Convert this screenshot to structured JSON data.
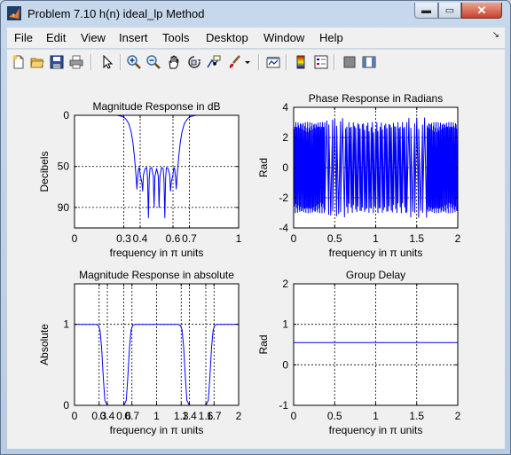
{
  "window": {
    "title": "Problem 7.10 h(n) ideal_lp Method",
    "min_glyph": "▬",
    "max_glyph": "▭",
    "close_glyph": "✕"
  },
  "menu": {
    "items": [
      "File",
      "Edit",
      "View",
      "Insert",
      "Tools",
      "Desktop",
      "Window",
      "Help"
    ],
    "corner_glyph": "↘"
  },
  "toolbar": {
    "icons": [
      "new-figure-icon",
      "open-file-icon",
      "save-icon",
      "print-icon",
      "pointer-icon",
      "zoom-in-icon",
      "zoom-out-icon",
      "pan-hand-icon",
      "rotate-3d-icon",
      "data-cursor-icon",
      "brush-icon",
      "brush-dropdown-icon",
      "link-plot-icon",
      "colorbar-icon",
      "legend-icon",
      "hide-plot-tools-icon",
      "show-plot-tools-icon"
    ]
  },
  "colors": {
    "line": "#0000ff",
    "axes_bg": "#ffffff",
    "figure_bg": "#f0f0f0",
    "grid": "#000000"
  },
  "chart_data": [
    {
      "type": "line",
      "title": "Magnitude Response in dB",
      "xlabel": "frequency in π units",
      "ylabel": "Decibels",
      "xlim": [
        0,
        1
      ],
      "ylim": [
        0,
        110
      ],
      "y_reversed": true,
      "xticks": [
        0,
        0.3,
        0.4,
        0.6,
        0.7,
        1
      ],
      "xticklabels": [
        "0",
        "0.3",
        "0.4",
        "0.6",
        "0.7",
        "1"
      ],
      "yticks": [
        0,
        50,
        90
      ],
      "yticklabels": [
        "0",
        "50",
        "90"
      ],
      "grid": true,
      "series": [
        {
          "x": [
            0,
            0.26,
            0.29,
            0.31,
            0.33,
            0.345,
            0.355,
            0.365,
            0.375,
            0.38,
            0.385,
            0.39,
            0.395,
            0.4,
            0.41,
            0.415,
            0.42,
            0.43,
            0.44,
            0.445,
            0.45,
            0.455,
            0.46,
            0.47,
            0.48,
            0.485,
            0.49,
            0.5,
            0.51,
            0.515,
            0.52,
            0.53,
            0.54,
            0.545,
            0.55,
            0.555,
            0.56,
            0.57,
            0.58,
            0.585,
            0.59,
            0.6,
            0.605,
            0.61,
            0.615,
            0.62,
            0.625,
            0.635,
            0.645,
            0.655,
            0.67,
            0.69,
            0.71,
            0.74,
            1.0
          ],
          "y": [
            0,
            0,
            1,
            3,
            8,
            16,
            26,
            40,
            60,
            72,
            60,
            52,
            51,
            58,
            65,
            74,
            58,
            52,
            51,
            61,
            100,
            62,
            52,
            51,
            59,
            90,
            60,
            52,
            59,
            90,
            60,
            51,
            52,
            62,
            100,
            61,
            51,
            52,
            58,
            74,
            65,
            58,
            51,
            52,
            60,
            72,
            60,
            40,
            26,
            16,
            8,
            3,
            1,
            0,
            0
          ]
        }
      ]
    },
    {
      "type": "line",
      "title": "Phase Response in Radians",
      "xlabel": "frequency in π units",
      "ylabel": "Rad",
      "xlim": [
        0,
        2
      ],
      "ylim": [
        -4,
        4
      ],
      "xticks": [
        0,
        0.5,
        1,
        1.5,
        2
      ],
      "xticklabels": [
        "0",
        "0.5",
        "1",
        "1.5",
        "2"
      ],
      "yticks": [
        -4,
        -2,
        0,
        2,
        4
      ],
      "yticklabels": [
        "-4",
        "-2",
        "0",
        "2",
        "4"
      ],
      "grid": true,
      "series": [
        {
          "pattern": "sawtooth",
          "bands": [
            [
              0,
              0.38,
              3.0,
              28
            ],
            [
              0.38,
              0.62,
              3.3,
              5
            ],
            [
              0.62,
              1.38,
              3.0,
              28
            ],
            [
              1.38,
              1.62,
              3.3,
              5
            ],
            [
              1.62,
              2.0,
              3.0,
              28
            ]
          ]
        }
      ]
    },
    {
      "type": "line",
      "title": "Magnitude Response in absolute",
      "xlabel": "frequency in π units",
      "ylabel": "Absolute",
      "xlim": [
        0,
        2
      ],
      "ylim": [
        0,
        1.5
      ],
      "xticks": [
        0,
        0.3,
        0.4,
        0.6,
        0.7,
        1,
        1.3,
        1.4,
        1.6,
        1.7,
        2
      ],
      "xticklabels": [
        "0",
        "0.3",
        "0.4",
        "0.6",
        "0.7",
        "1",
        "1.3",
        "1.4",
        "1.6",
        "1.7",
        "2"
      ],
      "yticks": [
        0,
        1
      ],
      "yticklabels": [
        "0",
        "1"
      ],
      "grid": true,
      "series": [
        {
          "x": [
            0,
            0.26,
            0.29,
            0.31,
            0.33,
            0.35,
            0.37,
            0.4,
            0.6,
            0.63,
            0.65,
            0.67,
            0.69,
            0.71,
            0.74,
            1.26,
            1.29,
            1.31,
            1.33,
            1.35,
            1.37,
            1.4,
            1.6,
            1.63,
            1.65,
            1.67,
            1.69,
            1.71,
            1.74,
            2.0
          ],
          "y": [
            1,
            1,
            0.99,
            0.93,
            0.72,
            0.35,
            0.06,
            0,
            0,
            0.06,
            0.35,
            0.72,
            0.93,
            0.99,
            1,
            1,
            0.99,
            0.93,
            0.72,
            0.35,
            0.06,
            0,
            0,
            0.06,
            0.35,
            0.72,
            0.93,
            0.99,
            1,
            1
          ]
        }
      ]
    },
    {
      "type": "line",
      "title": "Group Delay",
      "xlabel": "frequency in π units",
      "ylabel": "Rad",
      "xlim": [
        0,
        2
      ],
      "ylim": [
        -1,
        2
      ],
      "xticks": [
        0,
        0.5,
        1,
        1.5,
        2
      ],
      "xticklabels": [
        "0",
        "0.5",
        "1",
        "1.5",
        "2"
      ],
      "yticks": [
        -1,
        0,
        1,
        2
      ],
      "yticklabels": [
        "-1",
        "0",
        "1",
        "2"
      ],
      "grid": true,
      "series": [
        {
          "x": [
            0,
            2
          ],
          "y": [
            0.55,
            0.55
          ]
        }
      ]
    }
  ]
}
